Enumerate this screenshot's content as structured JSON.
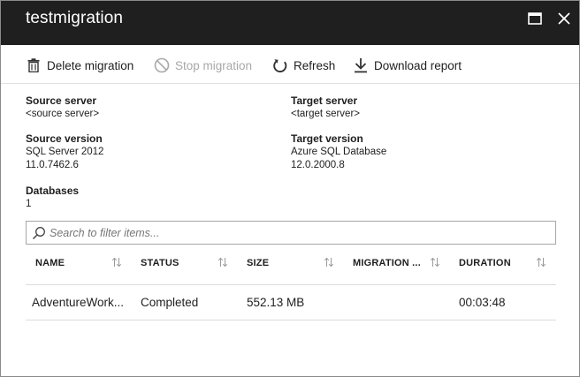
{
  "window": {
    "title": "testmigration",
    "maximize_icon": "maximize-icon",
    "close_icon": "close-icon"
  },
  "toolbar": {
    "delete_label": "Delete migration",
    "stop_label": "Stop migration",
    "refresh_label": "Refresh",
    "download_label": "Download report",
    "stop_disabled": true
  },
  "source": {
    "server_label": "Source server",
    "server_value": "<source server>",
    "version_label": "Source version",
    "version_name": "SQL Server 2012",
    "version_number": "11.0.7462.6"
  },
  "target": {
    "server_label": "Target server",
    "server_value": "<target server>",
    "version_label": "Target version",
    "version_name": "Azure SQL Database",
    "version_number": "12.0.2000.8"
  },
  "databases": {
    "label": "Databases",
    "value": "1"
  },
  "filter": {
    "placeholder": "Search to filter items..."
  },
  "table": {
    "columns": [
      "NAME",
      "STATUS",
      "SIZE",
      "MIGRATION ...",
      "DURATION"
    ],
    "rows": [
      {
        "name": "AdventureWork...",
        "status": "Completed",
        "size": "552.13 MB",
        "migration": "",
        "duration": "00:03:48"
      }
    ]
  },
  "colors": {
    "titlebar": "#1f1f1f",
    "disabled_text": "#a8a8a8"
  }
}
